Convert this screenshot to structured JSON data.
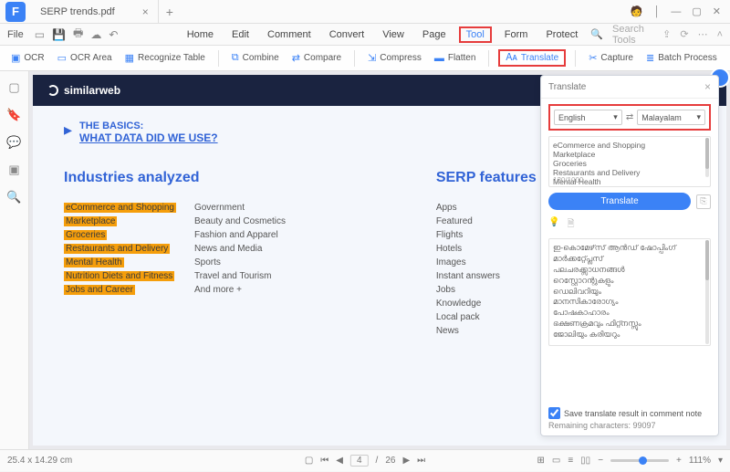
{
  "window": {
    "tab_title": "SERP trends.pdf",
    "avatar_glyph": "🧑"
  },
  "menubar": {
    "file": "File",
    "items": [
      "Home",
      "Edit",
      "Comment",
      "Convert",
      "View",
      "Page",
      "Tool",
      "Form",
      "Protect"
    ],
    "active_index": 6,
    "search_placeholder": "Search Tools"
  },
  "toolbar": {
    "ocr": "OCR",
    "ocr_area": "OCR Area",
    "recognize_table": "Recognize Table",
    "combine": "Combine",
    "compare": "Compare",
    "compress": "Compress",
    "flatten": "Flatten",
    "translate": "Translate",
    "capture": "Capture",
    "batch": "Batch Process"
  },
  "document": {
    "brand": "similarweb",
    "basics_label": "THE BASICS:",
    "basics_question": "WHAT DATA DID WE USE?",
    "col1_heading": "Industries analyzed",
    "col2_heading": "SERP features",
    "industries_highlighted": [
      "eCommerce and Shopping",
      "Marketplace",
      "Groceries",
      "Restaurants and Delivery",
      "Mental Health",
      "Nutrition Diets and Fitness",
      "Jobs and Career"
    ],
    "industries_plain": [
      "Government",
      "Beauty and Cosmetics",
      "Fashion and Apparel",
      "News and Media",
      "Sports",
      "Travel and Tourism",
      "And more +"
    ],
    "serp_features": [
      "Apps",
      "Featured",
      "Flights",
      "Hotels",
      "Images",
      "Instant answers",
      "Jobs",
      "Knowledge",
      "Local pack",
      "News"
    ]
  },
  "translate_panel": {
    "title": "Translate",
    "lang_from": "English",
    "lang_to": "Malayalam",
    "source_lines": [
      "eCommerce and Shopping",
      "Marketplace",
      "Groceries",
      "Restaurants and Delivery",
      "Mental Health"
    ],
    "char_counter": "130/1000",
    "button": "Translate",
    "output_text": "ഇ-കൊമേഴ്‌സ് ആൻഡ് ഷോപ്പിംഗ്\nമാർക്കറ്റ്പ്ലേസ്\nപലചരക്ക്സാധനങ്ങൾ\nറെസ്റ്റോറന്റുകളും\nഡെലിവറിയും\nമാനസികാരോഗ്യം\nപോഷകാഹാരം\nഭക്ഷണക്രമവും ഫിറ്റ്നസ്സും\nജോലിയും കരിയറും",
    "save_label": "Save translate result in comment note",
    "remaining": "Remaining characters: 99097"
  },
  "statusbar": {
    "dims": "25.4 x 14.29 cm",
    "page_current": "4",
    "page_total": "26",
    "zoom": "111%"
  }
}
